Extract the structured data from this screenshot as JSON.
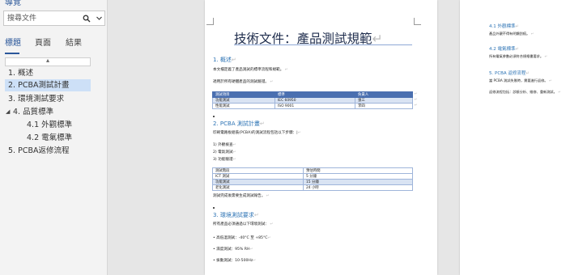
{
  "nav": {
    "title": "導覽",
    "search_placeholder": "搜尋文件",
    "tabs": [
      "標題",
      "頁面",
      "結果"
    ],
    "headings": [
      {
        "label": "1. 概述",
        "level": 1,
        "selected": false
      },
      {
        "label": "2. PCBA測試計畫",
        "level": 1,
        "selected": true
      },
      {
        "label": "3. 環境測試要求",
        "level": 1,
        "selected": false
      },
      {
        "label": "4. 品質標準",
        "level": 1,
        "selected": false,
        "expanded": true
      },
      {
        "label": "4.1 外觀標準",
        "level": 2,
        "selected": false
      },
      {
        "label": "4.2 電氣標準",
        "level": 2,
        "selected": false
      },
      {
        "label": "5. PCBA返修流程",
        "level": 1,
        "selected": false
      }
    ]
  },
  "page1": {
    "title": "技術文件：產品測試規範",
    "s1_heading": "1. 概述",
    "s1_p1": "本文檔定義了產品測試的標準流程和規範。",
    "s1_p2": "適用於所有硬體產品的測試驗證。",
    "table1": {
      "headers": [
        "測試項目",
        "標準",
        "負責人"
      ],
      "rows": [
        [
          "功能測試",
          "IEC 60950",
          "張三"
        ],
        [
          "性能測試",
          "ISO 9001",
          "李四"
        ]
      ]
    },
    "s2_heading": "2. PCBA 測試計畫",
    "s2_p1": "印刷電路板組裝(PCBA)的測試流程包括以下步驟：",
    "s2_list": [
      "1) 外觀檢查",
      "2) 電氣測試",
      "3) 功能驗證"
    ],
    "table2": {
      "headers": [
        "測試階段",
        "預估時間"
      ],
      "rows": [
        [
          "ICT 測試",
          "5 分鐘"
        ],
        [
          "功能測試",
          "15 分鐘"
        ],
        [
          "老化測試",
          "24 小時"
        ]
      ]
    },
    "s2_p2": "測試完成後需要生成測試報告。",
    "s3_heading": "3. 環境測試要求",
    "s3_p1": "所有產品必須通過以下環境測試：",
    "s3_list": [
      "• 高低溫測試：-40°C 至 +85°C",
      "• 濕度測試：95% RH",
      "• 振動測試：10-500Hz"
    ]
  },
  "page2": {
    "h41": "4.1 外觀標準",
    "p41": "產品外觀不得有明顯刮痕。",
    "h42": "4.2 電氣標準",
    "p42": "所有電氣參數必須符合規格書要求。",
    "h5": "5. PCBA 返修流程",
    "p5a": "當 PCBA 測試失敗時，需要進行返修。",
    "p5b": "返修流程包括：診斷分析、維修、重新測試。"
  },
  "colors": {
    "accent": "#2b579a",
    "heading": "#2e74b5",
    "table_header": "#4a6fb0",
    "selected_bg": "#cde0f7"
  }
}
